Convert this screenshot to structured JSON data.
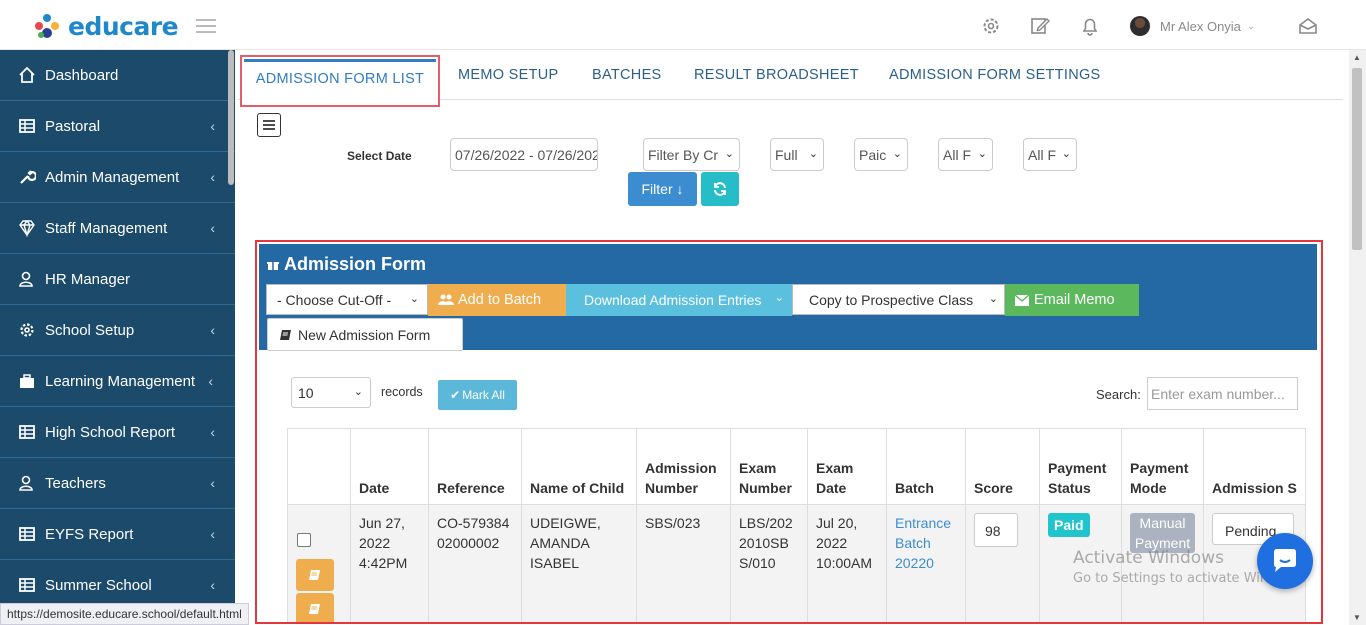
{
  "app": {
    "logo_text": "educare"
  },
  "header": {
    "user_name": "Mr Alex Onyia"
  },
  "sidebar": {
    "items": [
      {
        "label": "Dashboard",
        "icon": "home-icon",
        "has_children": false
      },
      {
        "label": "Pastoral",
        "icon": "table-icon",
        "has_children": true
      },
      {
        "label": "Admin Management",
        "icon": "wrench-icon",
        "has_children": true
      },
      {
        "label": "Staff Management",
        "icon": "diamond-icon",
        "has_children": true
      },
      {
        "label": "HR Manager",
        "icon": "users-icon",
        "has_children": false
      },
      {
        "label": "School Setup",
        "icon": "gear-icon",
        "has_children": true
      },
      {
        "label": "Learning Management",
        "icon": "briefcase-icon",
        "has_children": true
      },
      {
        "label": "High School Report",
        "icon": "table-icon",
        "has_children": true
      },
      {
        "label": "Teachers",
        "icon": "users-icon",
        "has_children": true
      },
      {
        "label": "EYFS Report",
        "icon": "table-icon",
        "has_children": true
      },
      {
        "label": "Summer School",
        "icon": "table-icon",
        "has_children": true
      }
    ]
  },
  "status_url": "https://demosite.educare.school/default.html",
  "tabs": [
    {
      "label": "ADMISSION FORM LIST",
      "active": true
    },
    {
      "label": "MEMO SETUP"
    },
    {
      "label": "BATCHES"
    },
    {
      "label": "RESULT BROADSHEET"
    },
    {
      "label": "ADMISSION FORM SETTINGS"
    }
  ],
  "filters": {
    "select_date_label": "Select Date",
    "date_range": "07/26/2022 - 07/26/202",
    "filter_by": "Filter By Cr",
    "full": "Full",
    "paid": "Paic",
    "all1": "All F",
    "all2": "All F",
    "filter_button": "Filter ↓"
  },
  "panel": {
    "title": "Admission Form",
    "cutoff_select": "- Choose Cut-Off -",
    "add_to_batch": "Add to Batch",
    "download_entries": "Download Admission Entries",
    "copy_to_class": "Copy to Prospective Class",
    "email_memo": "Email Memo",
    "new_form": "New Admission Form"
  },
  "table_controls": {
    "records_value": "10",
    "records_label": "records",
    "mark_all": "Mark All",
    "search_label": "Search:",
    "search_placeholder": "Enter exam number..."
  },
  "table": {
    "headers": [
      "",
      "Date",
      "Reference",
      "Name of Child",
      "Admission Number",
      "Exam Number",
      "Exam Date",
      "Batch",
      "Score",
      "Payment Status",
      "Payment Mode",
      "Admission S"
    ],
    "rows": [
      {
        "date": "Jun 27, 2022 4:42PM",
        "reference": "CO-57938402000002",
        "name": "UDEIGWE, AMANDA ISABEL",
        "admission_number": "SBS/023",
        "exam_number": "LBS/2022010SBS/010",
        "exam_date": "Jul 20, 2022 10:00AM",
        "batch": "Entrance Batch 20220",
        "score": "98",
        "payment_status": "Paid",
        "payment_mode": "Manual Payment",
        "admission_status": "Pending"
      }
    ]
  },
  "watermark": {
    "line1": "Activate Windows",
    "line2": "Go to Settings to activate Windows."
  },
  "colors": {
    "sidebar": "#1b4a6b",
    "panel_header": "#2468a4",
    "accent": "#3c8dd0",
    "highlight_border": "#e5353f"
  }
}
